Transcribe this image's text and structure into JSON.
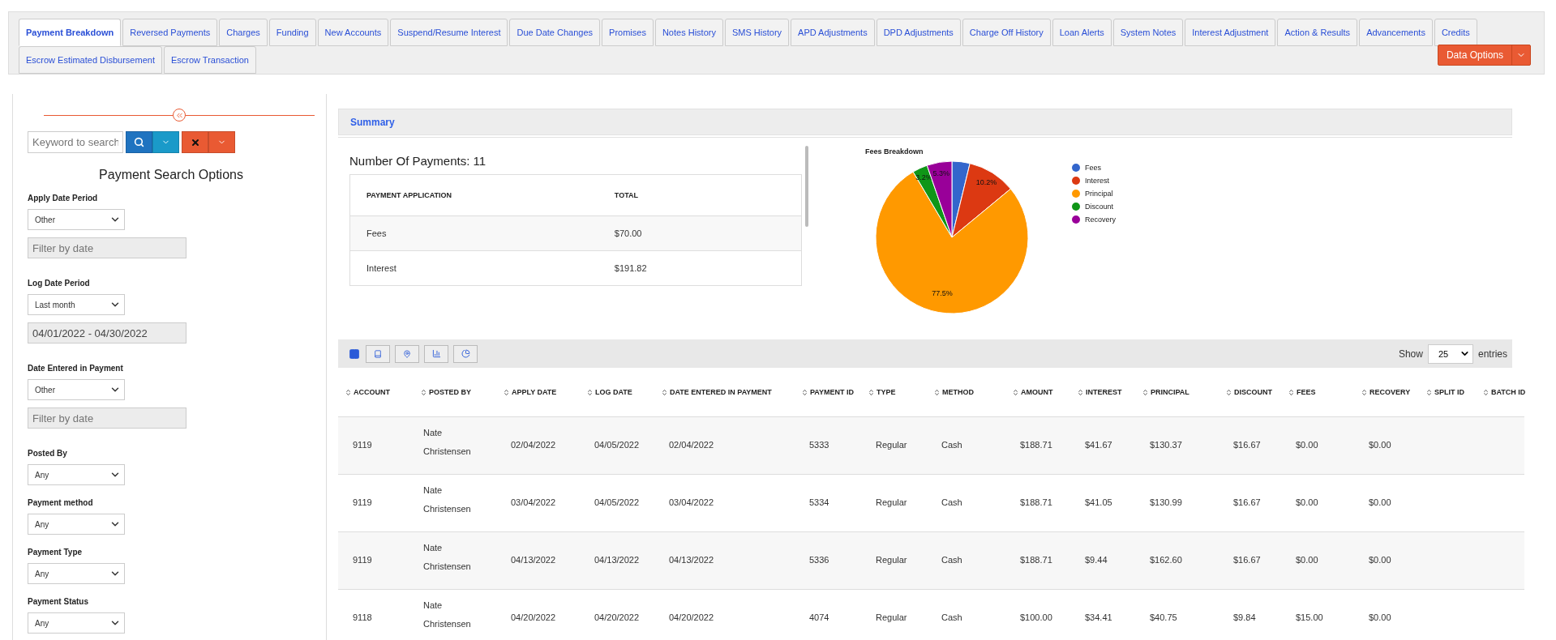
{
  "tabs": [
    {
      "label": "Payment Breakdown",
      "selected": true
    },
    {
      "label": "Reversed Payments",
      "selected": false
    },
    {
      "label": "Charges",
      "selected": false
    },
    {
      "label": "Funding",
      "selected": false
    },
    {
      "label": "New Accounts",
      "selected": false
    },
    {
      "label": "Suspend/Resume Interest",
      "selected": false
    },
    {
      "label": "Due Date Changes",
      "selected": false
    },
    {
      "label": "Promises",
      "selected": false
    },
    {
      "label": "Notes History",
      "selected": false
    },
    {
      "label": "SMS History",
      "selected": false
    },
    {
      "label": "APD Adjustments",
      "selected": false
    },
    {
      "label": "DPD Adjustments",
      "selected": false
    },
    {
      "label": "Charge Off History",
      "selected": false
    },
    {
      "label": "Loan Alerts",
      "selected": false
    },
    {
      "label": "System Notes",
      "selected": false
    },
    {
      "label": "Interest Adjustment",
      "selected": false
    },
    {
      "label": "Action & Results",
      "selected": false
    },
    {
      "label": "Advancements",
      "selected": false
    },
    {
      "label": "Credits",
      "selected": false
    },
    {
      "label": "Escrow Estimated Disbursement",
      "selected": false
    },
    {
      "label": "Escrow Transaction",
      "selected": false
    }
  ],
  "data_options_button": "Data Options",
  "sidebar": {
    "search": {
      "placeholder": "Keyword to search"
    },
    "title": "Payment Search Options",
    "filters": [
      {
        "kind": "select",
        "label": "Apply Date Period",
        "value": "Other",
        "date": {
          "placeholder": "Filter by date"
        }
      },
      {
        "kind": "select",
        "label": "Log Date Period",
        "value": "Last month",
        "date": {
          "value": "04/01/2022 - 04/30/2022"
        }
      },
      {
        "kind": "select",
        "label": "Date Entered in Payment",
        "value": "Other",
        "date": {
          "placeholder": "Filter by date"
        }
      },
      {
        "kind": "select",
        "label": "Posted By",
        "value": "Any"
      },
      {
        "kind": "select",
        "label": "Payment method",
        "value": "Any"
      },
      {
        "kind": "select",
        "label": "Payment Type",
        "value": "Any"
      },
      {
        "kind": "select",
        "label": "Payment Status",
        "value": "Any"
      }
    ]
  },
  "summary": {
    "title": "Summary",
    "count_label": "Number Of Payments: 11",
    "columns": [
      "PAYMENT APPLICATION",
      "TOTAL"
    ],
    "rows": [
      [
        "Fees",
        "$70.00"
      ],
      [
        "Interest",
        "$191.82"
      ]
    ],
    "chart_data": {
      "type": "pie",
      "title": "Fees Breakdown",
      "categories": [
        "Fees",
        "Interest",
        "Principal",
        "Discount",
        "Recovery"
      ],
      "series": [
        {
          "values": [
            3.8,
            10.2,
            77.5,
            3.2,
            5.3
          ]
        }
      ],
      "colors": [
        "#3366cc",
        "#dc3912",
        "#ff9900",
        "#109618",
        "#990099"
      ],
      "value_labels": [
        null,
        "10.2%",
        "77.5%",
        "3.2%",
        "5.3%"
      ],
      "legend": true
    }
  },
  "table": {
    "page_size": {
      "prefix": "Show",
      "value": "25",
      "suffix": "entries"
    },
    "columns": [
      "ACCOUNT",
      "POSTED BY",
      "APPLY DATE",
      "LOG DATE",
      "DATE ENTERED IN PAYMENT",
      "PAYMENT ID",
      "TYPE",
      "METHOD",
      "AMOUNT",
      "INTEREST",
      "PRINCIPAL",
      "DISCOUNT",
      "FEES",
      "RECOVERY",
      "SPLIT ID",
      "BATCH ID"
    ],
    "rows": [
      [
        "9119",
        "Nate Christensen",
        "02/04/2022",
        "04/05/2022",
        "02/04/2022",
        "5333",
        "Regular",
        "Cash",
        "$188.71",
        "$41.67",
        "$130.37",
        "$16.67",
        "$0.00",
        "$0.00",
        "",
        ""
      ],
      [
        "9119",
        "Nate Christensen",
        "03/04/2022",
        "04/05/2022",
        "03/04/2022",
        "5334",
        "Regular",
        "Cash",
        "$188.71",
        "$41.05",
        "$130.99",
        "$16.67",
        "$0.00",
        "$0.00",
        "",
        ""
      ],
      [
        "9119",
        "Nate Christensen",
        "04/13/2022",
        "04/13/2022",
        "04/13/2022",
        "5336",
        "Regular",
        "Cash",
        "$188.71",
        "$9.44",
        "$162.60",
        "$16.67",
        "$0.00",
        "$0.00",
        "",
        ""
      ],
      [
        "9118",
        "Nate Christensen",
        "04/20/2022",
        "04/20/2022",
        "04/20/2022",
        "4074",
        "Regular",
        "Cash",
        "$100.00",
        "$34.41",
        "$40.75",
        "$9.84",
        "$15.00",
        "$0.00",
        "",
        ""
      ]
    ]
  }
}
